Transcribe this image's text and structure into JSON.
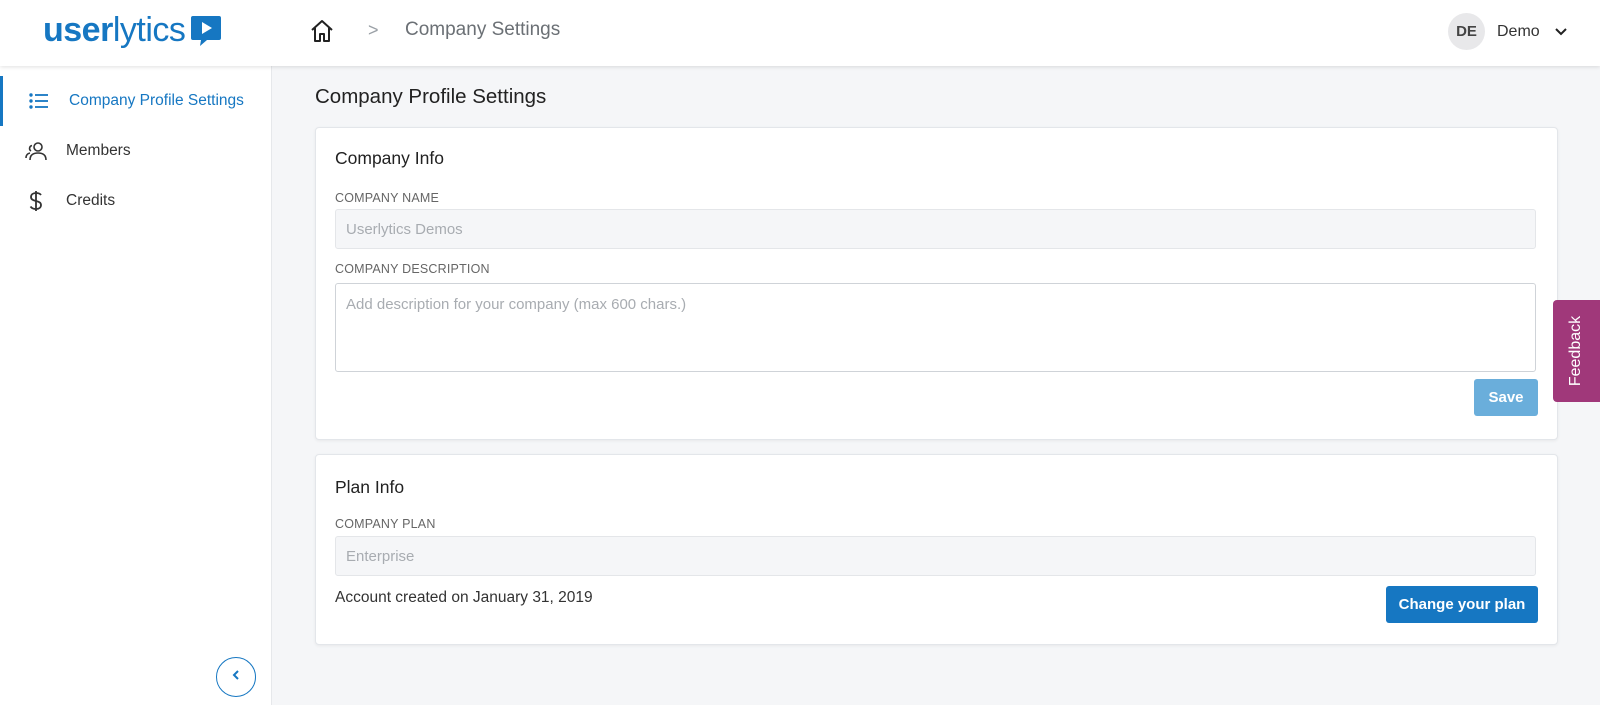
{
  "brand": {
    "logo_user": "user",
    "logo_lytics": "lytics",
    "accent": "#1677c2"
  },
  "header": {
    "breadcrumb_separator": ">",
    "breadcrumb_title": "Company Settings",
    "user_initials": "DE",
    "user_name": "Demo"
  },
  "sidebar": {
    "items": [
      {
        "label": "Company Profile Settings",
        "icon": "list-icon",
        "active": true
      },
      {
        "label": "Members",
        "icon": "members-icon",
        "active": false
      },
      {
        "label": "Credits",
        "icon": "dollar-icon",
        "active": false
      }
    ]
  },
  "main": {
    "page_title": "Company Profile Settings",
    "company_info": {
      "title": "Company Info",
      "name_label": "COMPANY NAME",
      "name_value": "Userlytics Demos",
      "description_label": "COMPANY DESCRIPTION",
      "description_placeholder": "Add description for your company (max 600 chars.)",
      "save_label": "Save"
    },
    "plan_info": {
      "title": "Plan Info",
      "plan_label": "COMPANY PLAN",
      "plan_value": "Enterprise",
      "created_text": "Account created on January 31, 2019",
      "change_plan_label": "Change your plan"
    }
  },
  "feedback": {
    "label": "Feedback",
    "color": "#a0387a"
  }
}
